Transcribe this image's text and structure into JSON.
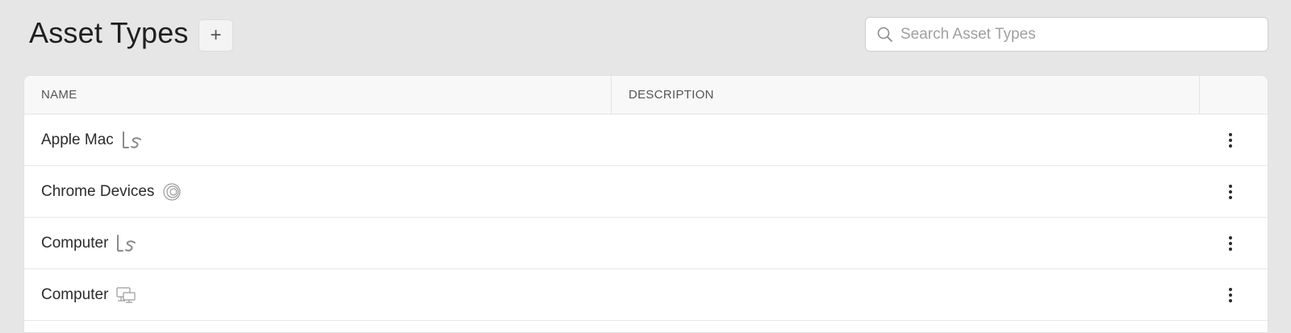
{
  "header": {
    "title": "Asset Types",
    "add_label": "+"
  },
  "search": {
    "placeholder": "Search Asset Types",
    "value": ""
  },
  "table": {
    "columns": [
      "NAME",
      "DESCRIPTION",
      ""
    ],
    "rows": [
      {
        "name": "Apple Mac",
        "description": "",
        "icon": "ls-logo-icon"
      },
      {
        "name": "Chrome Devices",
        "description": "",
        "icon": "target-circles-icon"
      },
      {
        "name": "Computer",
        "description": "",
        "icon": "ls-logo-icon"
      },
      {
        "name": "Computer",
        "description": "",
        "icon": "monitor-network-icon"
      }
    ]
  },
  "colors": {
    "background": "#e6e6e6",
    "table_header": "#f8f8f8",
    "icon_gray": "#8a8a8a"
  }
}
